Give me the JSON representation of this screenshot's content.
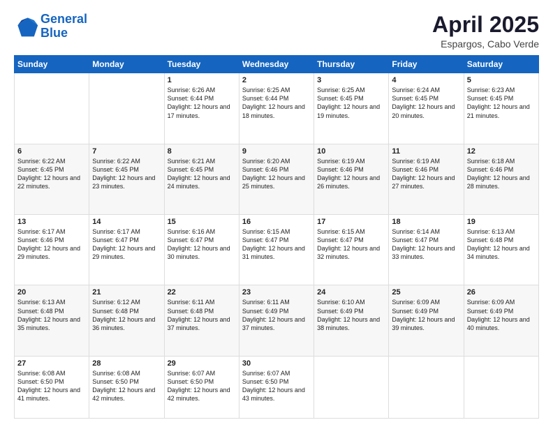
{
  "header": {
    "logo_line1": "General",
    "logo_line2": "Blue",
    "month": "April 2025",
    "location": "Espargos, Cabo Verde"
  },
  "weekdays": [
    "Sunday",
    "Monday",
    "Tuesday",
    "Wednesday",
    "Thursday",
    "Friday",
    "Saturday"
  ],
  "weeks": [
    [
      {
        "day": "",
        "info": ""
      },
      {
        "day": "",
        "info": ""
      },
      {
        "day": "1",
        "info": "Sunrise: 6:26 AM\nSunset: 6:44 PM\nDaylight: 12 hours and 17 minutes."
      },
      {
        "day": "2",
        "info": "Sunrise: 6:25 AM\nSunset: 6:44 PM\nDaylight: 12 hours and 18 minutes."
      },
      {
        "day": "3",
        "info": "Sunrise: 6:25 AM\nSunset: 6:45 PM\nDaylight: 12 hours and 19 minutes."
      },
      {
        "day": "4",
        "info": "Sunrise: 6:24 AM\nSunset: 6:45 PM\nDaylight: 12 hours and 20 minutes."
      },
      {
        "day": "5",
        "info": "Sunrise: 6:23 AM\nSunset: 6:45 PM\nDaylight: 12 hours and 21 minutes."
      }
    ],
    [
      {
        "day": "6",
        "info": "Sunrise: 6:22 AM\nSunset: 6:45 PM\nDaylight: 12 hours and 22 minutes."
      },
      {
        "day": "7",
        "info": "Sunrise: 6:22 AM\nSunset: 6:45 PM\nDaylight: 12 hours and 23 minutes."
      },
      {
        "day": "8",
        "info": "Sunrise: 6:21 AM\nSunset: 6:45 PM\nDaylight: 12 hours and 24 minutes."
      },
      {
        "day": "9",
        "info": "Sunrise: 6:20 AM\nSunset: 6:46 PM\nDaylight: 12 hours and 25 minutes."
      },
      {
        "day": "10",
        "info": "Sunrise: 6:19 AM\nSunset: 6:46 PM\nDaylight: 12 hours and 26 minutes."
      },
      {
        "day": "11",
        "info": "Sunrise: 6:19 AM\nSunset: 6:46 PM\nDaylight: 12 hours and 27 minutes."
      },
      {
        "day": "12",
        "info": "Sunrise: 6:18 AM\nSunset: 6:46 PM\nDaylight: 12 hours and 28 minutes."
      }
    ],
    [
      {
        "day": "13",
        "info": "Sunrise: 6:17 AM\nSunset: 6:46 PM\nDaylight: 12 hours and 29 minutes."
      },
      {
        "day": "14",
        "info": "Sunrise: 6:17 AM\nSunset: 6:47 PM\nDaylight: 12 hours and 29 minutes."
      },
      {
        "day": "15",
        "info": "Sunrise: 6:16 AM\nSunset: 6:47 PM\nDaylight: 12 hours and 30 minutes."
      },
      {
        "day": "16",
        "info": "Sunrise: 6:15 AM\nSunset: 6:47 PM\nDaylight: 12 hours and 31 minutes."
      },
      {
        "day": "17",
        "info": "Sunrise: 6:15 AM\nSunset: 6:47 PM\nDaylight: 12 hours and 32 minutes."
      },
      {
        "day": "18",
        "info": "Sunrise: 6:14 AM\nSunset: 6:47 PM\nDaylight: 12 hours and 33 minutes."
      },
      {
        "day": "19",
        "info": "Sunrise: 6:13 AM\nSunset: 6:48 PM\nDaylight: 12 hours and 34 minutes."
      }
    ],
    [
      {
        "day": "20",
        "info": "Sunrise: 6:13 AM\nSunset: 6:48 PM\nDaylight: 12 hours and 35 minutes."
      },
      {
        "day": "21",
        "info": "Sunrise: 6:12 AM\nSunset: 6:48 PM\nDaylight: 12 hours and 36 minutes."
      },
      {
        "day": "22",
        "info": "Sunrise: 6:11 AM\nSunset: 6:48 PM\nDaylight: 12 hours and 37 minutes."
      },
      {
        "day": "23",
        "info": "Sunrise: 6:11 AM\nSunset: 6:49 PM\nDaylight: 12 hours and 37 minutes."
      },
      {
        "day": "24",
        "info": "Sunrise: 6:10 AM\nSunset: 6:49 PM\nDaylight: 12 hours and 38 minutes."
      },
      {
        "day": "25",
        "info": "Sunrise: 6:09 AM\nSunset: 6:49 PM\nDaylight: 12 hours and 39 minutes."
      },
      {
        "day": "26",
        "info": "Sunrise: 6:09 AM\nSunset: 6:49 PM\nDaylight: 12 hours and 40 minutes."
      }
    ],
    [
      {
        "day": "27",
        "info": "Sunrise: 6:08 AM\nSunset: 6:50 PM\nDaylight: 12 hours and 41 minutes."
      },
      {
        "day": "28",
        "info": "Sunrise: 6:08 AM\nSunset: 6:50 PM\nDaylight: 12 hours and 42 minutes."
      },
      {
        "day": "29",
        "info": "Sunrise: 6:07 AM\nSunset: 6:50 PM\nDaylight: 12 hours and 42 minutes."
      },
      {
        "day": "30",
        "info": "Sunrise: 6:07 AM\nSunset: 6:50 PM\nDaylight: 12 hours and 43 minutes."
      },
      {
        "day": "",
        "info": ""
      },
      {
        "day": "",
        "info": ""
      },
      {
        "day": "",
        "info": ""
      }
    ]
  ]
}
